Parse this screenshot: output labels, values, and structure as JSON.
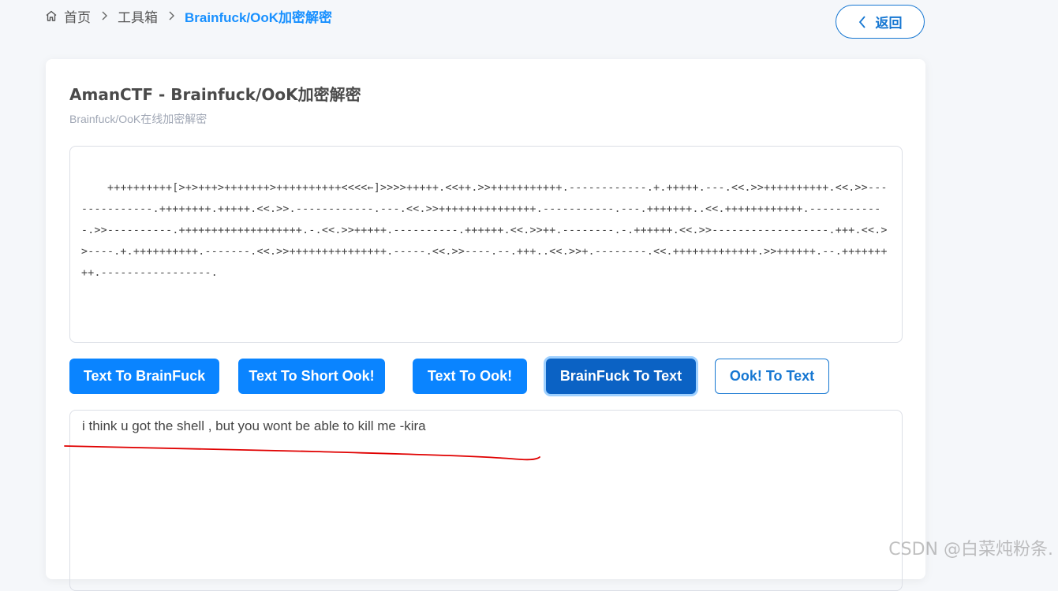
{
  "breadcrumb": {
    "home": "首页",
    "toolbox": "工具箱",
    "current": "Brainfuck/OoK加密解密"
  },
  "back_button": {
    "label": "返回"
  },
  "card": {
    "title": "AmanCTF - Brainfuck/OoK加密解密",
    "subtitle": "Brainfuck/OoK在线加密解密"
  },
  "input": {
    "value": "++++++++++[>+>+++>+++++++>++++++++++<<<<←]>>>>+++++.<<++.>>+++++++++++.------------.+.+++++.---.<<.>>++++++++++.<<.>>--------------.++++++++.+++++.<<.>>.------------.---.<<.>>+++++++++++++++.-----------.---.+++++++..<<.++++++++++++.------------.>>----------.+++++++++++++++++++.-.<<.>>+++++.----------.++++++.<<.>>++.--------.-.++++++.<<.>>------------------.+++.<<.>>----.+.++++++++++.-------.<<.>>+++++++++++++++.-----.<<.>>----.--.+++..<<.>>+.--------.<<.+++++++++++++.>>++++++.--.+++++++++.-----------------."
  },
  "buttons": [
    {
      "label": "Text To BrainFuck",
      "state": "primary"
    },
    {
      "label": "Text To Short Ook!",
      "state": "primary"
    },
    {
      "label": "Text To Ook!",
      "state": "primary"
    },
    {
      "label": "BrainFuck To Text",
      "state": "active"
    },
    {
      "label": "Ook! To Text",
      "state": "outline"
    }
  ],
  "output": {
    "value": "i think u got the shell , but you wont be able to kill me -kira"
  },
  "watermark": "CSDN @白菜炖粉条.",
  "icons": {
    "home": "home-icon",
    "separator": "chevron-right-icon",
    "back": "chevron-left-icon"
  },
  "colors": {
    "accent": "#1890ff",
    "primary_button": "#0a84ff",
    "active_button": "#0b62c4",
    "annotation": "#e00000"
  }
}
